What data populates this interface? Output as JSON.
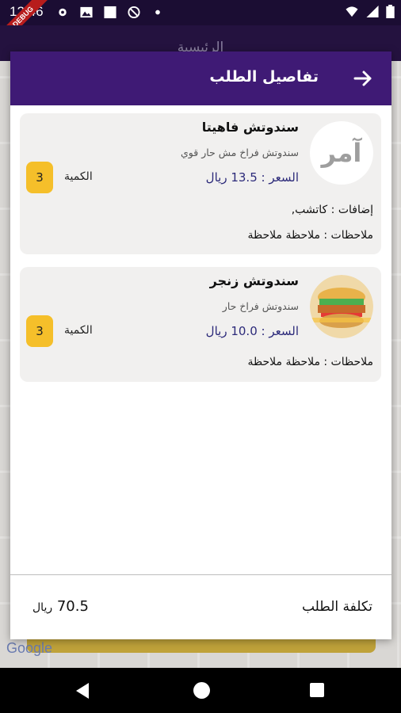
{
  "status_bar": {
    "time": "12:46",
    "debug_banner": "DEBUG"
  },
  "background": {
    "appbar_title": "الرئيسية",
    "map_attribution": "Google"
  },
  "dialog": {
    "title": "تفاصيل الطلب",
    "items": [
      {
        "avatar_text": "آمر",
        "name": "سندوتش فاهيتا",
        "description": "سندوتش فراخ مش حار قوي",
        "price_label": "السعر :",
        "price": "13.5",
        "currency": "ريال",
        "quantity_label": "الكمية",
        "quantity": "3",
        "extras": "إضافات : كاتشب,",
        "notes": "ملاحظات : ملاحظة ملاحظة"
      },
      {
        "name": "سندوتش زنجر",
        "description": "سندوتش فراخ حار",
        "price_label": "السعر :",
        "price": "10.0",
        "currency": "ريال",
        "quantity_label": "الكمية",
        "quantity": "3",
        "notes": "ملاحظات : ملاحظة ملاحظة"
      }
    ],
    "footer": {
      "total_label": "تكلفة الطلب",
      "total": "70.5",
      "currency": "ريال"
    }
  },
  "colors": {
    "header": "#3f1a75",
    "quantity_badge": "#f5bf2a",
    "price_text": "#2c2a7a"
  }
}
